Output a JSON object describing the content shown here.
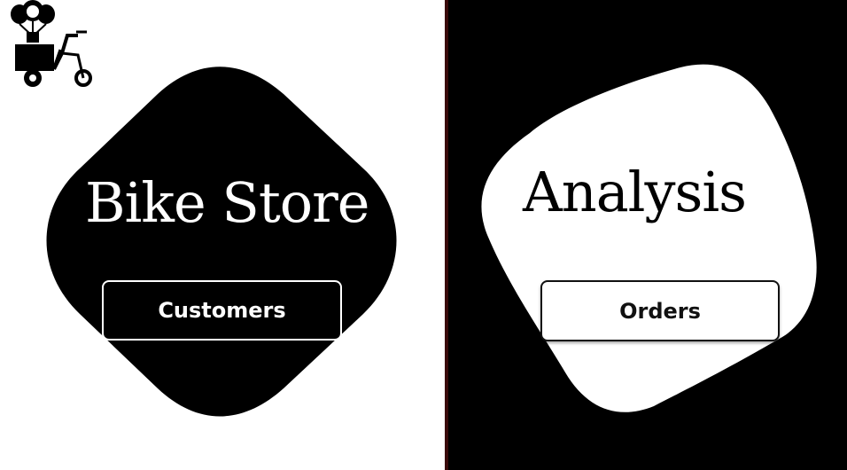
{
  "left_panel": {
    "title": "Bike Store",
    "button_label": "Customers",
    "logo_icon": "bike-delivery-icon"
  },
  "right_panel": {
    "title": "Analysis",
    "button_label": "Orders"
  },
  "colors": {
    "left_background": "#ffffff",
    "right_background": "#000000",
    "divider": "#3a0a0a",
    "blob_left": "#000000",
    "blob_right": "#ffffff"
  }
}
